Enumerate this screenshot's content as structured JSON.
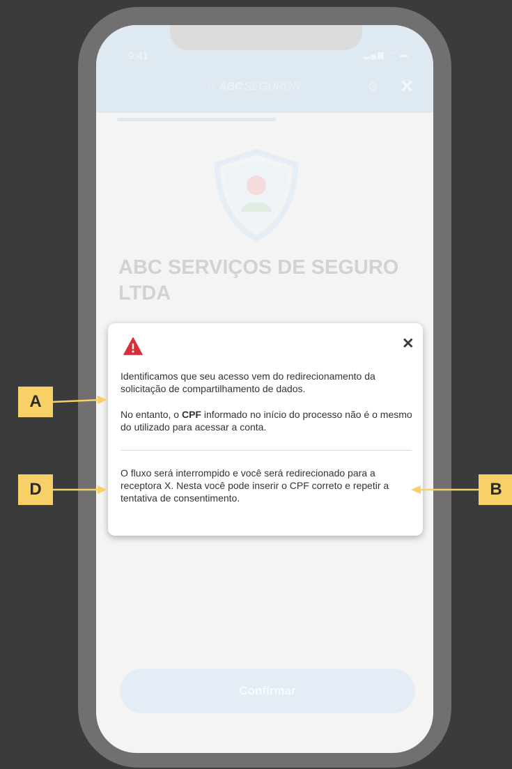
{
  "status_bar": {
    "time": "9:41",
    "icons": "signal wifi battery"
  },
  "header": {
    "brand_bold": "ABC",
    "brand_light": "SEGUROS"
  },
  "company": {
    "name": "ABC SERVIÇOS DE SEGURO LTDA"
  },
  "footer": {
    "confirm_label": "Confirmar"
  },
  "modal": {
    "close_symbol": "✕",
    "paragraph1": "Identificamos que seu acesso vem do redirecionamento da solicitação de compartilhamento de dados.",
    "paragraph2_before": "No entanto, o ",
    "paragraph2_bold": "CPF",
    "paragraph2_after": " informado no início do processo não é o mesmo do utilizado para acessar a conta.",
    "paragraph3": "O fluxo será interrompido e você será redirecionado para a receptora X. Nesta você pode inserir o CPF correto e repetir a tentativa de consentimento."
  },
  "callouts": {
    "a": "A",
    "d": "D",
    "b": "B"
  },
  "colors": {
    "callout": "#f7d167",
    "warning": "#d6303a",
    "header_bg": "#dfe9f2",
    "frame": "#716f6f",
    "background": "#3b3b3b"
  }
}
